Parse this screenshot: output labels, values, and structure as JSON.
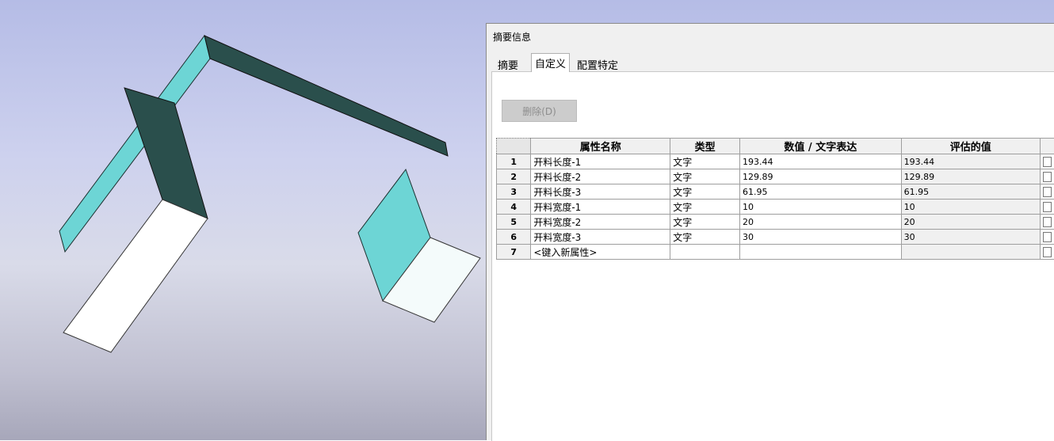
{
  "dialog": {
    "title": "摘要信息",
    "tabs": [
      {
        "label": "摘要",
        "active": false
      },
      {
        "label": "自定义",
        "active": true
      },
      {
        "label": "配置特定",
        "active": false
      }
    ],
    "delete_button": "删除(D)",
    "table": {
      "headers": [
        "属性名称",
        "类型",
        "数值 / 文字表达",
        "评估的值"
      ],
      "rows": [
        {
          "num": "1",
          "name": "开料长度-1",
          "type": "文字",
          "value": "193.44",
          "evaluated": "193.44"
        },
        {
          "num": "2",
          "name": "开料长度-2",
          "type": "文字",
          "value": "129.89",
          "evaluated": "129.89"
        },
        {
          "num": "3",
          "name": "开料长度-3",
          "type": "文字",
          "value": "61.95",
          "evaluated": "61.95"
        },
        {
          "num": "4",
          "name": "开料宽度-1",
          "type": "文字",
          "value": "10",
          "evaluated": "10"
        },
        {
          "num": "5",
          "name": "开料宽度-2",
          "type": "文字",
          "value": "20",
          "evaluated": "20"
        },
        {
          "num": "6",
          "name": "开料宽度-3",
          "type": "文字",
          "value": "30",
          "evaluated": "30"
        },
        {
          "num": "7",
          "name": "<键入新属性>",
          "type": "",
          "value": "",
          "evaluated": ""
        }
      ]
    }
  },
  "colors": {
    "panel_dark": "#2a4f4c",
    "panel_cyan": "#6dd5d5",
    "panel_white": "#f4fbfb"
  }
}
